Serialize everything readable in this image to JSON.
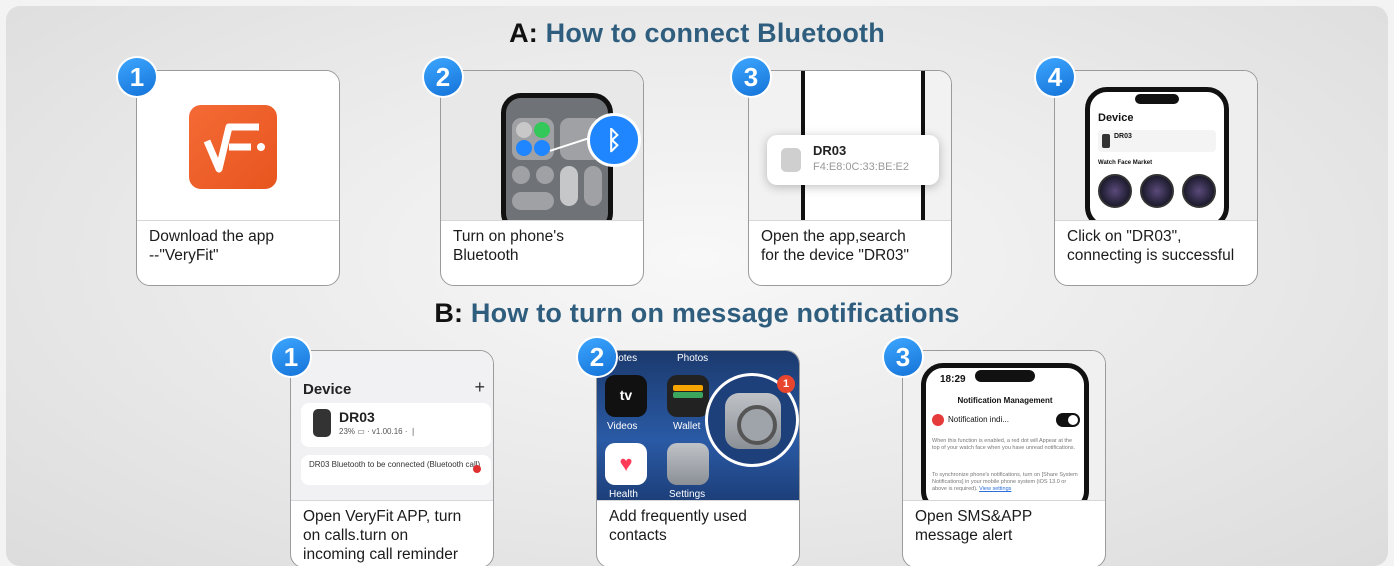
{
  "sectionA": {
    "letter": "A:",
    "title": "How to connect Bluetooth",
    "steps": [
      {
        "number": "1",
        "caption_line1": "Download the app",
        "caption_line2": "--\"VeryFit\""
      },
      {
        "number": "2",
        "caption_line1": "Turn on phone's",
        "caption_line2": "Bluetooth"
      },
      {
        "number": "3",
        "caption_line1": "Open the app,search",
        "caption_line2": "for the device \"DR03\"",
        "popup_name": "DR03",
        "popup_mac": "F4:E8:0C:33:BE:E2"
      },
      {
        "number": "4",
        "caption_line1": "Click on \"DR03\",",
        "caption_line2": "connecting is successful",
        "screen_title": "Device",
        "screen_device": "DR03",
        "screen_market": "Watch Face Market"
      }
    ]
  },
  "sectionB": {
    "letter": "B:",
    "title": "How to turn on message notifications",
    "steps": [
      {
        "number": "1",
        "caption_line1": "Open VeryFit APP, turn",
        "caption_line2": "on calls.turn on",
        "caption_line3": "incoming call reminder",
        "screen_title": "Device",
        "device_name": "DR03",
        "device_meta": "23%  ▭  · v1.00.16 · ❘",
        "note": "DR03 Bluetooth to be connected (Bluetooth call)"
      },
      {
        "number": "2",
        "caption_line1": "Add frequently used",
        "caption_line2": "contacts",
        "labels": {
          "notes": "Notes",
          "photos": "Photos",
          "videos": "Videos",
          "wallet": "Wallet",
          "health": "Health",
          "settings": "Settings",
          "tv": "tv"
        }
      },
      {
        "number": "3",
        "caption_line1": "Open SMS&APP",
        "caption_line2": "message alert",
        "time": "18:29",
        "screen_title": "Notification Management",
        "row_label": "Notification indi...",
        "text1": "When this function is enabled, a red dot will Appear at the top of your watch face when you have unread notifications.",
        "text2": "To synchronize phone's notifications, turn on [Share System Notifications] in your mobile phone system (iOS 13.0 or above is required).",
        "link": "View settings"
      }
    ]
  }
}
